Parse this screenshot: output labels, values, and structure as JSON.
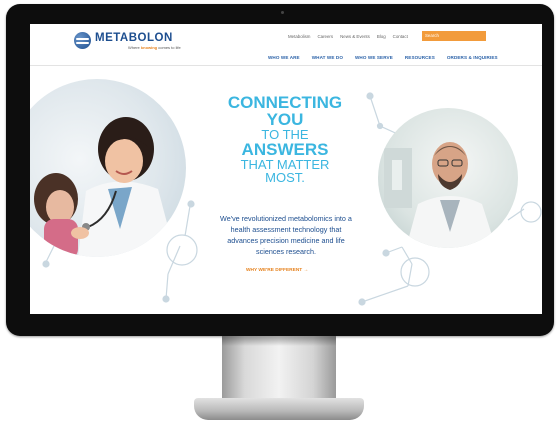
{
  "brand": {
    "logo_text": "METABOLON",
    "tagline_prefix": "Where",
    "tagline_emphasis": "knowing",
    "tagline_suffix": "comes to life"
  },
  "top_links": [
    "Metabolism",
    "Careers",
    "News & Events",
    "Blog",
    "Contact"
  ],
  "search": {
    "placeholder": "Search"
  },
  "main_nav": [
    "WHO WE ARE",
    "WHAT WE DO",
    "WHO WE SERVE",
    "RESOURCES",
    "ORDERS & INQUIRIES"
  ],
  "hero": {
    "headline": [
      "CONNECTING",
      "YOU",
      "TO THE",
      "ANSWERS",
      "THAT MATTER",
      "MOST."
    ],
    "body": "We've revolutionized metabolomics into a health assessment technology that advances precision medicine and life sciences research.",
    "cta": "WHY WE'RE DIFFERENT →"
  },
  "colors": {
    "accent_orange": "#f29b3b",
    "brand_blue": "#1d4e8f",
    "headline_cyan": "#3bb6e0"
  }
}
